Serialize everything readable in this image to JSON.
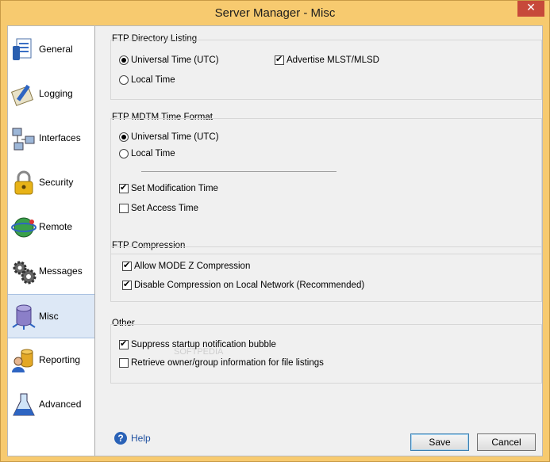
{
  "window": {
    "title": "Server Manager - Misc",
    "close_glyph": "✕"
  },
  "sidebar": {
    "items": [
      {
        "label": "General",
        "icon": "general-doc-icon"
      },
      {
        "label": "Logging",
        "icon": "logging-pen-icon"
      },
      {
        "label": "Interfaces",
        "icon": "network-icon"
      },
      {
        "label": "Security",
        "icon": "lock-icon"
      },
      {
        "label": "Remote",
        "icon": "remote-globe-icon"
      },
      {
        "label": "Messages",
        "icon": "gears-icon"
      },
      {
        "label": "Misc",
        "icon": "database-icon"
      },
      {
        "label": "Reporting",
        "icon": "reporting-user-icon"
      },
      {
        "label": "Advanced",
        "icon": "flask-icon"
      }
    ],
    "active": "Misc"
  },
  "ftp_directory_listing": {
    "title": "FTP Directory Listing",
    "utc_label": "Universal Time (UTC)",
    "local_label": "Local Time",
    "selected": "utc",
    "advertise_label": "Advertise MLST/MLSD",
    "advertise_checked": true
  },
  "ftp_mdtm": {
    "title": "FTP MDTM Time Format",
    "utc_label": "Universal Time (UTC)",
    "local_label": "Local Time",
    "selected": "utc",
    "set_modification_label": "Set Modification Time",
    "set_modification_checked": true,
    "set_access_label": "Set Access Time",
    "set_access_checked": false
  },
  "ftp_compression": {
    "title": "FTP Compression",
    "allow_label": "Allow MODE Z Compression",
    "allow_checked": true,
    "disable_local_label": "Disable Compression on Local Network (Recommended)",
    "disable_local_checked": true
  },
  "other": {
    "title": "Other",
    "suppress_label": "Suppress startup notification bubble",
    "suppress_checked": true,
    "retrieve_label": "Retrieve owner/group information for file listings",
    "retrieve_checked": false
  },
  "footer": {
    "help_label": "Help",
    "save_label": "Save",
    "cancel_label": "Cancel"
  },
  "colors": {
    "frame": "#f7ca6f",
    "close": "#c7493a",
    "active_nav": "#dde8f6"
  }
}
